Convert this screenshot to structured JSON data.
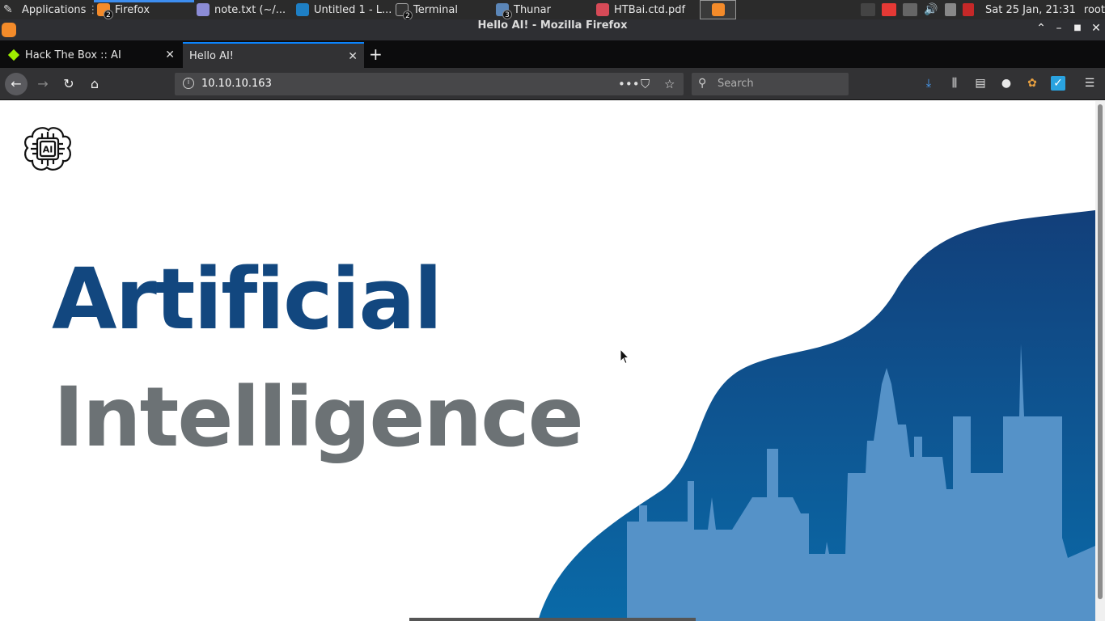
{
  "taskbar": {
    "applications_label": "Applications",
    "items": [
      {
        "label": "Firefox",
        "badge": "2",
        "icon": "firefox-icon"
      },
      {
        "label": "note.txt (~/...",
        "icon": "text-editor-icon"
      },
      {
        "label": "Untitled 1 - L...",
        "icon": "writer-icon"
      },
      {
        "label": "Terminal",
        "badge": "2",
        "icon": "terminal-icon"
      },
      {
        "label": "Thunar",
        "badge": "3",
        "icon": "folder-icon"
      },
      {
        "label": "HTBai.ctd.pdf",
        "icon": "pdf-icon"
      }
    ],
    "clock": "Sat 25 Jan, 21:31",
    "user": "root"
  },
  "window": {
    "title": "Hello AI! - Mozilla Firefox"
  },
  "tabs": [
    {
      "label": "Hack The Box :: AI",
      "active": false
    },
    {
      "label": "Hello AI!",
      "active": true
    }
  ],
  "navbar": {
    "url": "10.10.10.163",
    "search_placeholder": "Search"
  },
  "page": {
    "headline_line1": "Artificial",
    "headline_line2": "Intelligence",
    "logo_text": "AI"
  },
  "colors": {
    "headline_primary": "#12477f",
    "headline_secondary": "#6c7275",
    "wave_dark": "#0f4a8a",
    "skyline": "#5592c8"
  }
}
